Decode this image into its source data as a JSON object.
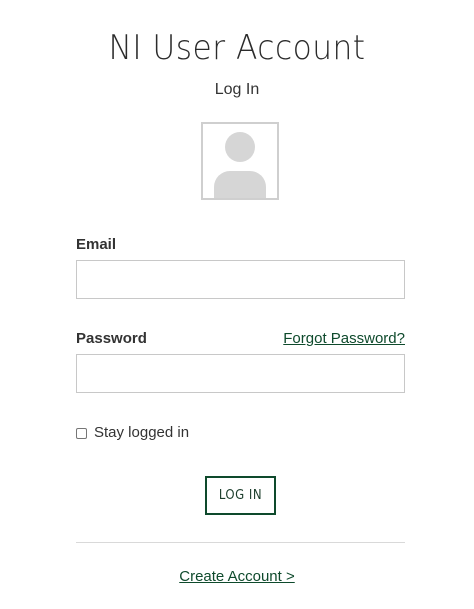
{
  "header": {
    "title": "NI User Account",
    "subtitle": "Log In"
  },
  "avatar": {
    "icon": "user-placeholder-icon"
  },
  "form": {
    "email_label": "Email",
    "email_value": "",
    "password_label": "Password",
    "password_value": "",
    "forgot_link": "Forgot Password?",
    "stay_logged_in_label": "Stay logged in",
    "stay_logged_in_checked": false,
    "login_button": "LOG IN"
  },
  "footer": {
    "create_account_link": "Create Account >"
  },
  "colors": {
    "accent": "#0e4a2c",
    "border": "#c8c8c8",
    "text": "#333333"
  }
}
